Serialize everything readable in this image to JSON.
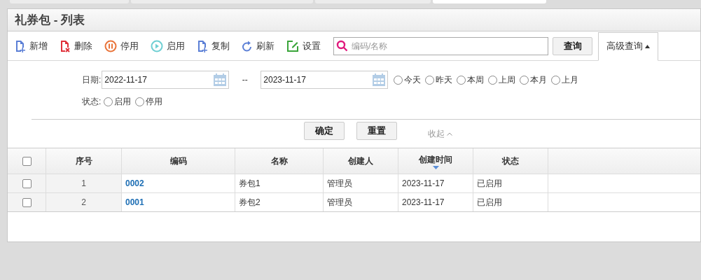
{
  "top_tabs": [
    {
      "selected": false
    },
    {
      "selected": false
    },
    {
      "selected": false
    },
    {
      "selected": true
    }
  ],
  "title": "礼券包 - 列表",
  "toolbar": [
    {
      "kind": "add",
      "label": "新增"
    },
    {
      "kind": "delete",
      "label": "删除"
    },
    {
      "kind": "pause",
      "label": "停用"
    },
    {
      "kind": "play",
      "label": "启用"
    },
    {
      "kind": "copy",
      "label": "复制"
    },
    {
      "kind": "refresh",
      "label": "刷新"
    },
    {
      "kind": "settings",
      "label": "设置"
    }
  ],
  "search": {
    "placeholder": "编码/名称",
    "button": "查询",
    "advanced": "高级查询",
    "advanced_expanded": true
  },
  "filters": {
    "date_label": "日期:",
    "date_from": "2022-11-17",
    "separator": "--",
    "date_to": "2023-11-17",
    "quick_dates": [
      {
        "label": "今天",
        "selected": false
      },
      {
        "label": "昨天",
        "selected": false
      },
      {
        "label": "本周",
        "selected": false
      },
      {
        "label": "上周",
        "selected": false
      },
      {
        "label": "本月",
        "selected": false
      },
      {
        "label": "上月",
        "selected": false
      }
    ],
    "status_label": "状态:",
    "statuses": [
      {
        "label": "启用",
        "selected": false
      },
      {
        "label": "停用",
        "selected": false
      }
    ],
    "confirm": "确定",
    "reset": "重置",
    "collapse": "收起"
  },
  "table": {
    "all_checked": false,
    "columns": [
      {
        "label": "序号",
        "sorted": false
      },
      {
        "label": "编码",
        "sorted": false
      },
      {
        "label": "名称",
        "sorted": false
      },
      {
        "label": "创建人",
        "sorted": false
      },
      {
        "label": "创建时间",
        "sorted": true
      },
      {
        "label": "状态",
        "sorted": false
      }
    ],
    "rows": [
      {
        "checked": false,
        "cells": [
          "1",
          "0002",
          "券包1",
          "管理员",
          "2023-11-17",
          "已启用"
        ]
      },
      {
        "checked": false,
        "cells": [
          "2",
          "0001",
          "券包2",
          "管理员",
          "2023-11-17",
          "已启用"
        ]
      }
    ]
  }
}
